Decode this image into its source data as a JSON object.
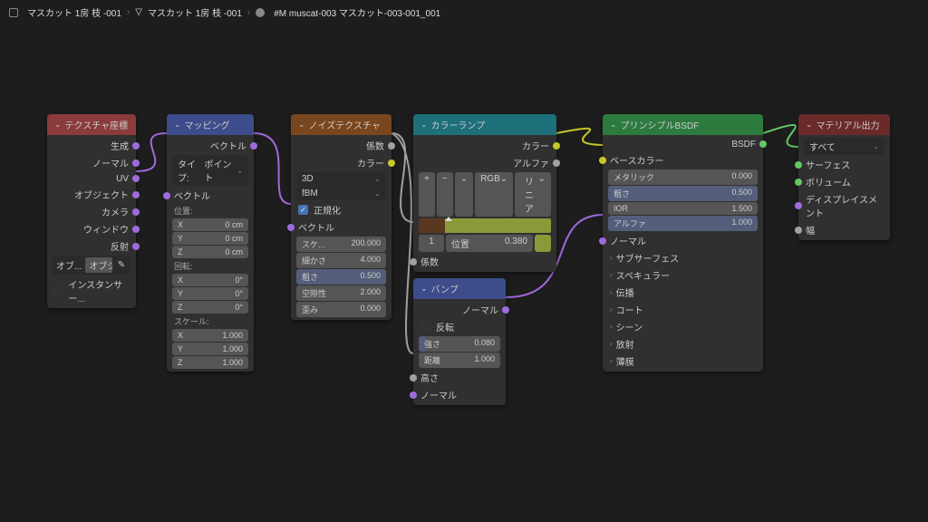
{
  "breadcrumb": {
    "a": "マスカット 1房 枝 -001",
    "b": "マスカット 1房 枝 -001",
    "c": "#M muscat-003 マスカット-003-001_001"
  },
  "texcoord": {
    "title": "テクスチャ座標",
    "out": [
      "生成",
      "ノーマル",
      "UV",
      "オブジェクト",
      "カメラ",
      "ウィンドウ",
      "反射"
    ],
    "obj_lbl": "オブ...",
    "obj_val": "オブジ...",
    "from_inst": "インスタンサー..."
  },
  "mapping": {
    "title": "マッピング",
    "out_vector": "ベクトル",
    "type_lbl": "タイプ:",
    "type_val": "ポイント",
    "in_vector": "ベクトル",
    "loc": "位置:",
    "rot": "回転:",
    "scale": "スケール:",
    "x": "X",
    "y": "Y",
    "z": "Z",
    "v0": "0 cm",
    "d0": "0°",
    "s1": "1.000"
  },
  "noise": {
    "title": "ノイズテクスチャ",
    "out_fac": "係数",
    "out_color": "カラー",
    "dim": "3D",
    "fbm": "fBM",
    "normalize": "正規化",
    "vector": "ベクトル",
    "p": [
      [
        "スケ...",
        "200.000"
      ],
      [
        "細かさ",
        "4.000"
      ],
      [
        "粗さ",
        "0.500"
      ],
      [
        "空隙性",
        "2.000"
      ],
      [
        "歪み",
        "0.000"
      ]
    ]
  },
  "ramp": {
    "title": "カラーランプ",
    "out_color": "カラー",
    "out_alpha": "アルファ",
    "mode1": "RGB",
    "mode2": "リニア",
    "plus": "+",
    "minus": "−",
    "dd": "⌄",
    "idx": "1",
    "pos_l": "位置",
    "pos_v": "0.380",
    "in_fac": "係数"
  },
  "bump": {
    "title": "バンプ",
    "out_normal": "ノーマル",
    "invert": "反転",
    "strength_l": "強さ",
    "strength_v": "0.080",
    "dist_l": "距離",
    "dist_v": "1.000",
    "height": "高さ",
    "normal": "ノーマル"
  },
  "bsdf": {
    "title": "プリンシプルBSDF",
    "out": "BSDF",
    "base": "ベースカラー",
    "p": [
      [
        "メタリック",
        "0.000"
      ],
      [
        "粗さ",
        "0.500"
      ],
      [
        "IOR",
        "1.500"
      ],
      [
        "アルファ",
        "1.000"
      ]
    ],
    "normal": "ノーマル",
    "groups": [
      "サブサーフェス",
      "スペキュラー",
      "伝播",
      "コート",
      "シーン",
      "放射",
      "薄膜"
    ]
  },
  "out": {
    "title": "マテリアル出力",
    "target": "すべて",
    "surface": "サーフェス",
    "volume": "ボリューム",
    "disp": "ディスプレイスメント",
    "thick": "幅"
  }
}
